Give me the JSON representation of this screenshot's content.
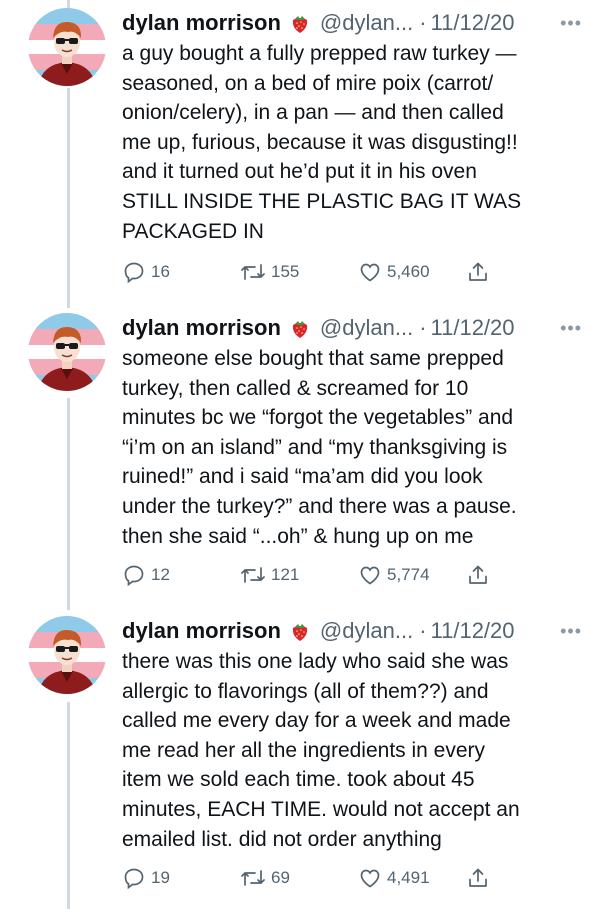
{
  "tweets": [
    {
      "author": {
        "name": "dylan morrison",
        "badge_icon": "strawberry-emoji",
        "handle": "@dylan...",
        "separator": "·",
        "date": "11/12/20"
      },
      "more_icon": "•••",
      "text_lines": [
        "a guy bought a fully prepped raw turkey —",
        "seasoned, on a bed of mire poix (carrot/",
        "onion/celery), in a pan — and then called",
        "me up, furious, because it was disgusting!!",
        "and it turned out he’d put it in his oven",
        "STILL INSIDE THE PLASTIC BAG IT WAS",
        "PACKAGED IN"
      ],
      "actions": {
        "replies": "16",
        "retweets": "155",
        "likes": "5,460"
      }
    },
    {
      "author": {
        "name": "dylan morrison",
        "badge_icon": "strawberry-emoji",
        "handle": "@dylan...",
        "separator": "·",
        "date": "11/12/20"
      },
      "more_icon": "•••",
      "text_lines": [
        "someone else bought that same prepped",
        "turkey, then called & screamed for 10",
        "minutes bc we “forgot the vegetables” and",
        "“i’m on an island” and “my thanksgiving is",
        "ruined!” and i said “ma’am did you look",
        "under the turkey?” and there was a pause.",
        "then she said “...oh” & hung up on me"
      ],
      "actions": {
        "replies": "12",
        "retweets": "121",
        "likes": "5,774"
      }
    },
    {
      "author": {
        "name": "dylan morrison",
        "badge_icon": "strawberry-emoji",
        "handle": "@dylan...",
        "separator": "·",
        "date": "11/12/20"
      },
      "more_icon": "•••",
      "text_lines": [
        "there was this one lady who said she was",
        "allergic to flavorings (all of them??) and",
        "called me every day for a week and made",
        "me read her all the ingredients in every",
        "item we sold each time. took about 45",
        "minutes, EACH TIME. would not accept an",
        "emailed list. did not order anything"
      ],
      "actions": {
        "replies": "19",
        "retweets": "69",
        "likes": "4,491"
      }
    }
  ],
  "colors": {
    "text": "#0f1419",
    "secondary": "#536471",
    "thread_line": "#cfd9de",
    "flag_blue": "#8fcbe9",
    "flag_pink": "#f2a9b8",
    "flag_white": "#ffffff"
  }
}
